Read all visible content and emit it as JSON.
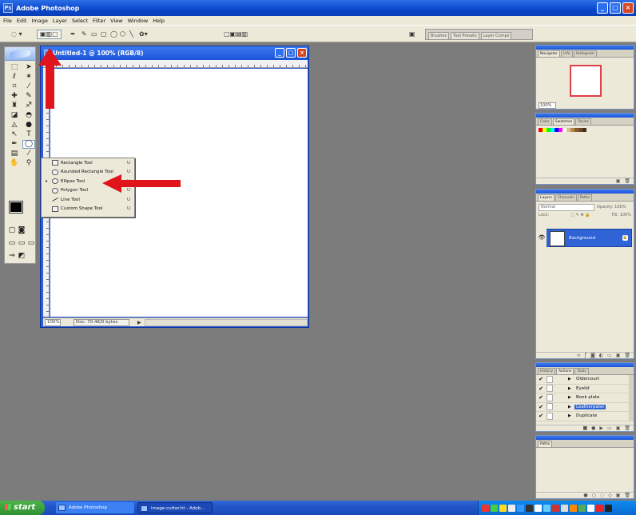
{
  "app": {
    "title": "Adobe Photoshop",
    "icon": "photoshop-icon"
  },
  "menu": [
    "File",
    "Edit",
    "Image",
    "Layer",
    "Select",
    "Filter",
    "View",
    "Window",
    "Help"
  ],
  "options_bar": {
    "well_tabs": [
      "Brushes",
      "Tool Presets",
      "Layer Comps"
    ]
  },
  "document": {
    "title": "Untitled-1 @ 100% (RGB/8)",
    "zoom": "100%",
    "doc_size": "Doc: 70.4K/0 bytes"
  },
  "shape_flyout": {
    "items": [
      {
        "label": "Rectangle Tool",
        "key": "U",
        "selected": false
      },
      {
        "label": "Rounded Rectangle Tool",
        "key": "U",
        "selected": false
      },
      {
        "label": "Ellipse Tool",
        "key": "U",
        "selected": true
      },
      {
        "label": "Polygon Tool",
        "key": "U",
        "selected": false
      },
      {
        "label": "Line Tool",
        "key": "U",
        "selected": false
      },
      {
        "label": "Custom Shape Tool",
        "key": "U",
        "selected": false
      }
    ]
  },
  "palettes": {
    "navigator": {
      "tabs": [
        "Navigator",
        "Info",
        "Histogram"
      ],
      "zoom": "100%"
    },
    "color": {
      "tabs": [
        "Color",
        "Swatches",
        "Styles"
      ]
    },
    "layers": {
      "tabs": [
        "Layers",
        "Channels",
        "Paths"
      ],
      "mode": "Normal",
      "opacity_label": "Opacity: 100%",
      "lock_label": "Lock:",
      "fill_label": "Fill: 100%",
      "layer_name": "Background"
    },
    "actions": {
      "tabs": [
        "History",
        "Actions",
        "Tools"
      ],
      "items": [
        {
          "name": "Oldercourt",
          "selected": false
        },
        {
          "name": "Eyelid",
          "selected": false
        },
        {
          "name": "Book plate",
          "selected": false
        },
        {
          "name": "Leatherpatel",
          "selected": true
        },
        {
          "name": "Duplicate",
          "selected": false
        }
      ]
    },
    "paths": {
      "tabs": [
        "Paths"
      ]
    }
  },
  "taskbar": {
    "start": "start",
    "tasks": [
      "Adobe Photoshop",
      "image-cutter.ht - Adob..."
    ]
  },
  "colors": {
    "accent": "#0a46c9",
    "arrow": "#e0141b",
    "selection": "#2f63d6"
  }
}
